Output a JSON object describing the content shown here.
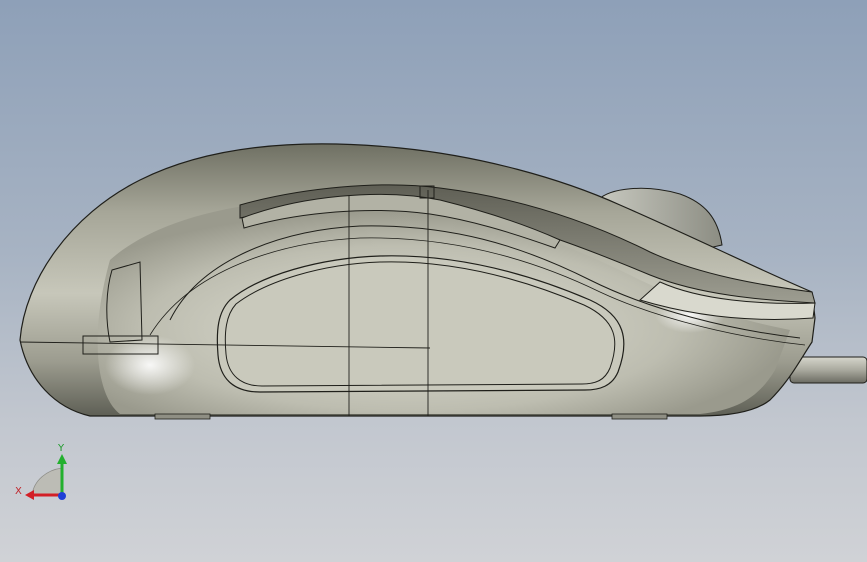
{
  "viewport": {
    "background_top": "#8ea0b8",
    "background_bottom": "#d0d2d6"
  },
  "model": {
    "body_color": "#b9b9ad",
    "edge_color": "#1f1f1a"
  },
  "triad": {
    "x_label": "X",
    "y_label": "Y",
    "x_color": "#d31f26",
    "y_color": "#22b02e",
    "z_color": "#1f3fd6"
  }
}
